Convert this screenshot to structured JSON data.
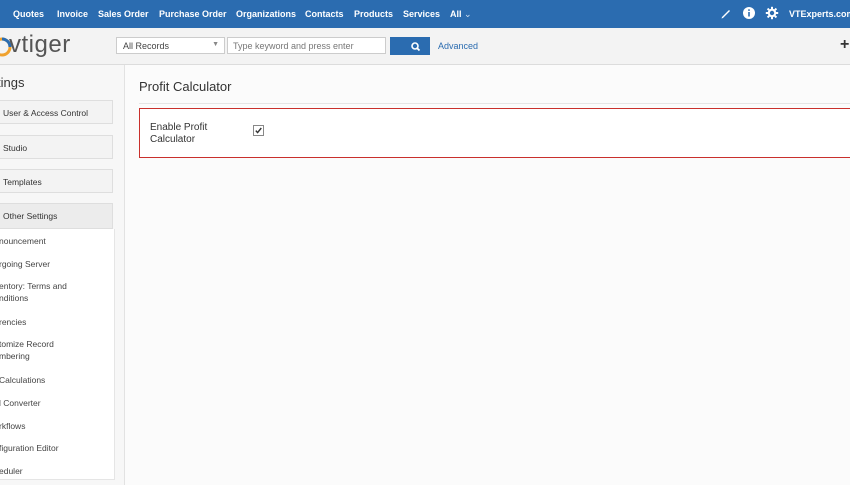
{
  "topnav": {
    "items": [
      "Quotes",
      "Invoice",
      "Sales Order",
      "Purchase Order",
      "Organizations",
      "Contacts",
      "Products",
      "Services",
      "All"
    ],
    "user": "VTExperts.com",
    "caret": "⌄"
  },
  "header": {
    "logo": "vtiger",
    "record_select": "All Records",
    "search_placeholder": "Type keyword and press enter",
    "advanced": "Advanced",
    "plus": "+"
  },
  "sidebar": {
    "title": "tings",
    "groups": [
      "User & Access Control",
      "Studio",
      "Templates",
      "Other Settings"
    ],
    "subitems": [
      "nouncement",
      "rgoing Server",
      "entory: Terms and",
      "nditions",
      "rencies",
      "tomize Record",
      "mbering",
      "Calculations",
      "l Converter",
      "rkflows",
      "figuration Editor",
      "eduler"
    ]
  },
  "main": {
    "title": "Profit Calculator",
    "label_line1": "Enable Profit",
    "label_line2": "Calculator",
    "enabled": true
  },
  "colors": {
    "nav": "#2b6cb0",
    "highlight_border": "#c9302c"
  }
}
